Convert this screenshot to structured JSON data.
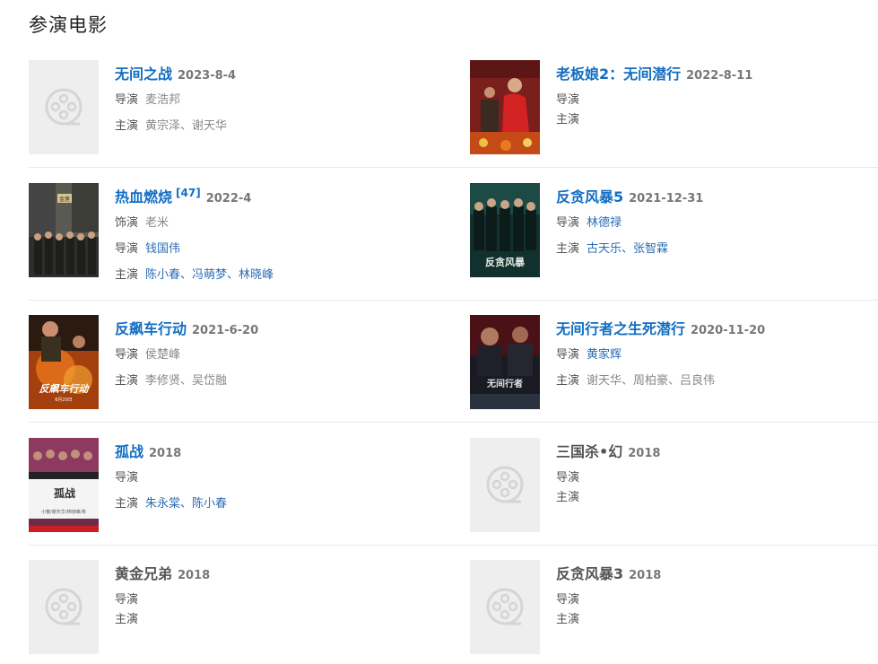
{
  "section_title": "参演电影",
  "films": [
    {
      "name": "无间之战",
      "date": "2023-8-4",
      "name_style": "link",
      "rows": [
        {
          "k": "导演",
          "v": "麦浩邦",
          "link": false
        },
        {
          "k": "主演",
          "v": "黄宗泽、谢天华",
          "link": false
        }
      ],
      "poster": "placeholder-film-icon"
    },
    {
      "name": "老板娘2：无间潜行",
      "date": "2022-8-11",
      "name_style": "link",
      "rows": [
        {
          "k": "导演",
          "v": "",
          "link": false
        },
        {
          "k": "主演",
          "v": "",
          "link": false
        }
      ],
      "poster": "poster-red-woman"
    },
    {
      "name": "热血燃烧",
      "ref": "[47]",
      "date": "2022-4",
      "name_style": "link",
      "rows": [
        {
          "k": "饰演",
          "v": "老米",
          "link": false
        },
        {
          "k": "导演",
          "v": "钱国伟",
          "link": true
        },
        {
          "k": "主演",
          "v": "陈小春、冯萌梦、林晓峰",
          "link": true
        }
      ],
      "poster": "poster-street-group"
    },
    {
      "name": "反贪风暴5",
      "date": "2021-12-31",
      "name_style": "link",
      "rows": [
        {
          "k": "导演",
          "v": "林德禄",
          "link": true
        },
        {
          "k": "主演",
          "v": "古天乐、张智霖",
          "link": true
        }
      ],
      "poster": "poster-green-team"
    },
    {
      "name": "反飙车行动",
      "date": "2021-6-20",
      "name_style": "link",
      "rows": [
        {
          "k": "导演",
          "v": "侯楚峰",
          "link": false
        },
        {
          "k": "主演",
          "v": "李修贤、吴岱融",
          "link": false
        }
      ],
      "poster": "poster-fire-action"
    },
    {
      "name": "无间行者之生死潜行",
      "date": "2020-11-20",
      "name_style": "link",
      "rows": [
        {
          "k": "导演",
          "v": "黄家辉",
          "link": true
        },
        {
          "k": "主演",
          "v": "谢天华、周柏豪、吕良伟",
          "link": false
        }
      ],
      "poster": "poster-dark-red"
    },
    {
      "name": "孤战",
      "date": "2018",
      "name_style": "link",
      "rows": [
        {
          "k": "导演",
          "v": "",
          "link": false
        },
        {
          "k": "主演",
          "v": "朱永棠、陈小春",
          "link": true
        }
      ],
      "poster": "poster-clapboard"
    },
    {
      "name": "三国杀•幻",
      "date": "2018",
      "name_style": "plain",
      "rows": [
        {
          "k": "导演",
          "v": "",
          "link": false
        },
        {
          "k": "主演",
          "v": "",
          "link": false
        }
      ],
      "poster": "placeholder-film-icon"
    },
    {
      "name": "黄金兄弟",
      "date": "2018",
      "name_style": "plain",
      "rows": [
        {
          "k": "导演",
          "v": "",
          "link": false
        },
        {
          "k": "主演",
          "v": "",
          "link": false
        }
      ],
      "poster": "placeholder-film-icon"
    },
    {
      "name": "反贪风暴3",
      "date": "2018",
      "name_style": "plain",
      "rows": [
        {
          "k": "导演",
          "v": "",
          "link": false
        },
        {
          "k": "主演",
          "v": "",
          "link": false
        }
      ],
      "poster": "placeholder-film-icon"
    }
  ],
  "poster_texts": {
    "street_sign": "金莲",
    "green_team_title": "反贪风暴",
    "fire_title": "反飙车行动",
    "fire_date": "6月20日",
    "dark_title": "无间行者",
    "clapboard_title": "孤战",
    "clapboard_names": "小春/谢天华/林晓峰/朱"
  },
  "colors": {
    "link": "#136ec2",
    "label": "#555555",
    "value": "#888888",
    "divider": "#e8e8e8"
  }
}
